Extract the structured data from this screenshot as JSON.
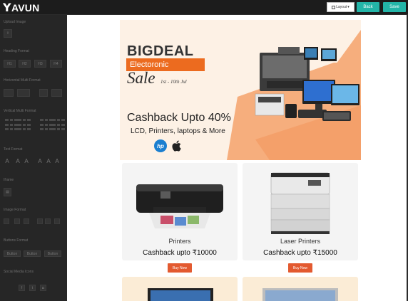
{
  "app": {
    "logo_text": "AVUN",
    "logo_mark": "Y"
  },
  "toolbar": {
    "layout_label": "Layout",
    "back_label": "Back",
    "save_label": "Save",
    "accent_color": "#23b5a8"
  },
  "sidebar": {
    "sections": {
      "upload_image": "Upload Image",
      "heading_format": "Heading Format",
      "horizontal_multi": "Horizontal Multi Format",
      "vertical_multi": "Vertical Multi Format",
      "text_format": "Text Format",
      "iframe": "Iframe",
      "image_format": "Image Format",
      "buttons_format": "Buttons Format",
      "social_media": "Social Media Icons"
    },
    "heading_buttons": [
      "H1",
      "H2",
      "H3",
      "H4"
    ],
    "text_glyphs": [
      "A",
      "A",
      "A",
      "A",
      "A",
      "A"
    ],
    "button_labels": [
      "Button",
      "Button",
      "Button"
    ]
  },
  "banner": {
    "title": "BIGDEAL",
    "category": "Electoronic",
    "sale": "Sale",
    "date": "1st - 10th Jul",
    "cashback": "Cashback Upto 40%",
    "items": "LCD, Printers, laptops & More",
    "brand_hp": "hp",
    "accent_color": "#ec6b1f",
    "background_color": "#f6ae7d"
  },
  "products": [
    {
      "name": "Printers",
      "cashback": "Cashback upto ₹10000",
      "button": "Buy Now"
    },
    {
      "name": "Laser Printers",
      "cashback": "Cashback upto ₹15000",
      "button": "Buy Now"
    }
  ]
}
